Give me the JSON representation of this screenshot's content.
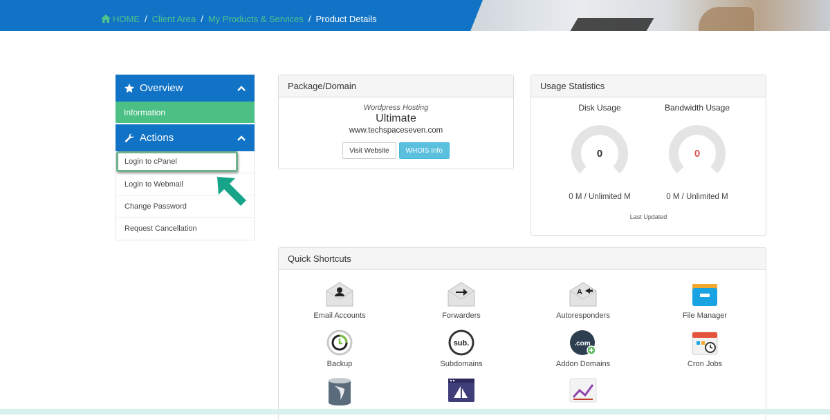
{
  "breadcrumb": {
    "home": "HOME",
    "client_area": "Client Area",
    "products": "My Products & Services",
    "current": "Product Details",
    "separator": "/"
  },
  "sidebar": {
    "overview": {
      "label": "Overview",
      "icon": "star-icon"
    },
    "overview_items": [
      {
        "label": "Information"
      }
    ],
    "actions": {
      "label": "Actions",
      "icon": "wrench-icon"
    },
    "action_items": [
      {
        "label": "Login to cPanel"
      },
      {
        "label": "Login to Webmail"
      },
      {
        "label": "Change Password"
      },
      {
        "label": "Request Cancellation"
      }
    ]
  },
  "package": {
    "title": "Package/Domain",
    "type": "Wordpress Hosting",
    "name": "Ultimate",
    "domain": "www.techspaceseven.com",
    "visit_label": "Visit Website",
    "whois_label": "WHOIS Info"
  },
  "usage": {
    "title": "Usage Statistics",
    "disk": {
      "label": "Disk Usage",
      "value": "0",
      "detail": "0 M / Unlimited M",
      "color": "#333333"
    },
    "bandwidth": {
      "label": "Bandwidth Usage",
      "value": "0",
      "detail": "0 M / Unlimited M",
      "color": "#d9534f"
    },
    "last_updated": "Last Updated"
  },
  "shortcuts": {
    "title": "Quick Shortcuts",
    "items": [
      {
        "label": "Email Accounts",
        "icon": "email-accounts-icon"
      },
      {
        "label": "Forwarders",
        "icon": "forwarders-icon"
      },
      {
        "label": "Autoresponders",
        "icon": "autoresponders-icon"
      },
      {
        "label": "File Manager",
        "icon": "file-manager-icon"
      },
      {
        "label": "Backup",
        "icon": "backup-icon"
      },
      {
        "label": "Subdomains",
        "icon": "subdomains-icon"
      },
      {
        "label": "Addon Domains",
        "icon": "addon-domains-icon"
      },
      {
        "label": "Cron Jobs",
        "icon": "cron-jobs-icon"
      },
      {
        "label": "",
        "icon": "mysql-database-icon"
      },
      {
        "label": "",
        "icon": "site-publisher-icon"
      },
      {
        "label": "",
        "icon": "awstats-chart-icon"
      }
    ]
  },
  "colors": {
    "primary": "#1173c6",
    "success": "#4cbf85",
    "info": "#5bc0de",
    "danger": "#d9534f",
    "highlight_border": "#6fb08d",
    "arrow": "#17a58a"
  }
}
